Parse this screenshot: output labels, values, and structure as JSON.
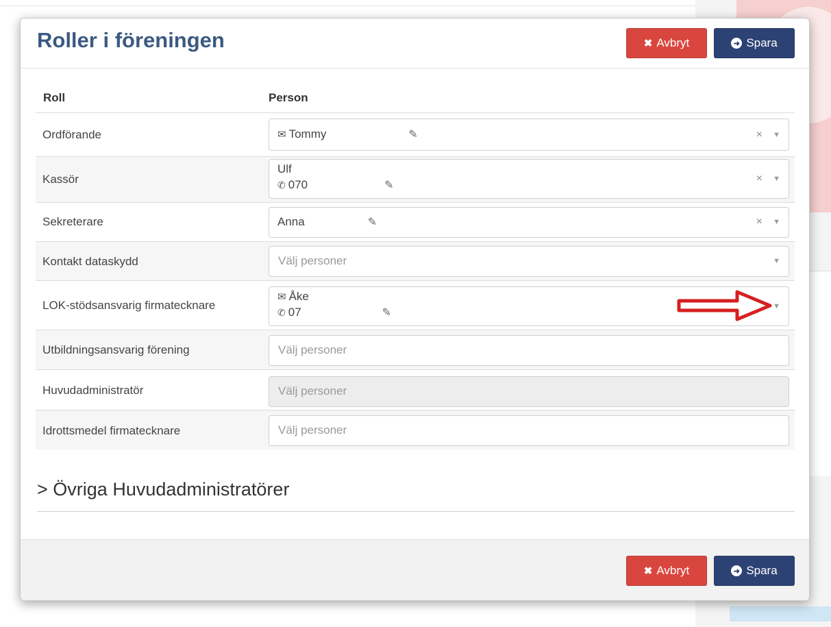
{
  "modal": {
    "title": "Roller i föreningen",
    "cancel_label": "Avbryt",
    "save_label": "Spara"
  },
  "table": {
    "col_role": "Roll",
    "col_person": "Person"
  },
  "rows": [
    {
      "role": "Ordförande",
      "line1": "Tommy",
      "line2": ""
    },
    {
      "role": "Kassör",
      "line1": "Ulf",
      "line2": "070"
    },
    {
      "role": "Sekreterare",
      "line1": "Anna",
      "line2": ""
    },
    {
      "role": "Kontakt dataskydd",
      "placeholder": "Välj personer"
    },
    {
      "role": "LOK-stödsansvarig firmatecknare",
      "line1": "Åke",
      "line2": "07"
    },
    {
      "role": "Utbildningsansvarig förening",
      "placeholder": "Välj personer"
    },
    {
      "role": "Huvudadministratör",
      "placeholder": "Välj personer"
    },
    {
      "role": "Idrottsmedel firmatecknare",
      "placeholder": "Välj personer"
    }
  ],
  "section": {
    "title": "Övriga Huvudadministratörer",
    "chevron": ">"
  },
  "icons": {
    "clear": "×",
    "caret": "▼",
    "edit": "✎"
  },
  "colors": {
    "title": "#3b5a82",
    "cancel": "#d9463e",
    "save": "#2d4274",
    "annotation_arrow": "#d62020"
  }
}
